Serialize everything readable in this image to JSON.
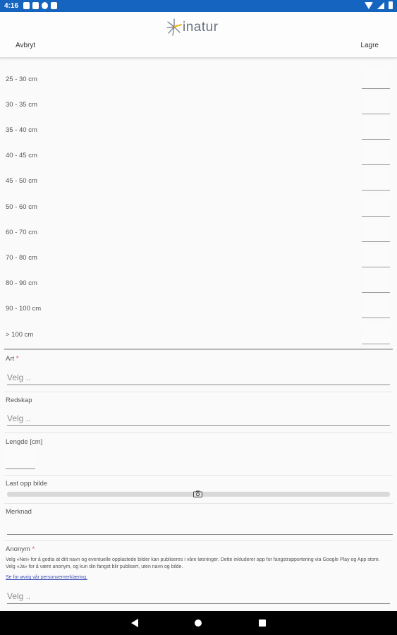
{
  "status": {
    "time": "4:16",
    "icons": [
      "notification-icon",
      "photo-icon",
      "flipboard-icon",
      "doc-icon"
    ]
  },
  "header": {
    "logo_text": "inatur",
    "cancel_label": "Avbryt",
    "save_label": "Lagre"
  },
  "size_rows": [
    "25 - 30 cm",
    "30 - 35 cm",
    "35 - 40 cm",
    "40 - 45 cm",
    "45 - 50 cm",
    "50 - 60 cm",
    "60 - 70 cm",
    "70 - 80 cm",
    "80 - 90 cm",
    "90 - 100 cm",
    "> 100 cm"
  ],
  "form": {
    "art": {
      "label": "Art",
      "required": "*",
      "value": "Velg .."
    },
    "redskap": {
      "label": "Redskap",
      "value": "Velg .."
    },
    "lengde": {
      "label": "Lengde [cm]"
    },
    "bilde": {
      "label": "Last opp bilde"
    },
    "merknad": {
      "label": "Merknad"
    },
    "anonym": {
      "label": "Anonym",
      "required": "*",
      "info": "Velg «Nei» for å godta at ditt navn og eventuelle opplastede bilder kan publiseres i våre løsninger. Dette inkluderer app for fangstrapportering via Google Play og App store. Velg «Ja» for å være anonym, og kun din fangst blir publisert, uten navn og bilde.",
      "link": "Se for øvrig vår personvernerklæring.",
      "value": "Velg .."
    }
  },
  "colors": {
    "status_bar": "#1565c0",
    "logo_star": "#f2a900",
    "link": "#3f51b5",
    "required": "#d9534f"
  }
}
